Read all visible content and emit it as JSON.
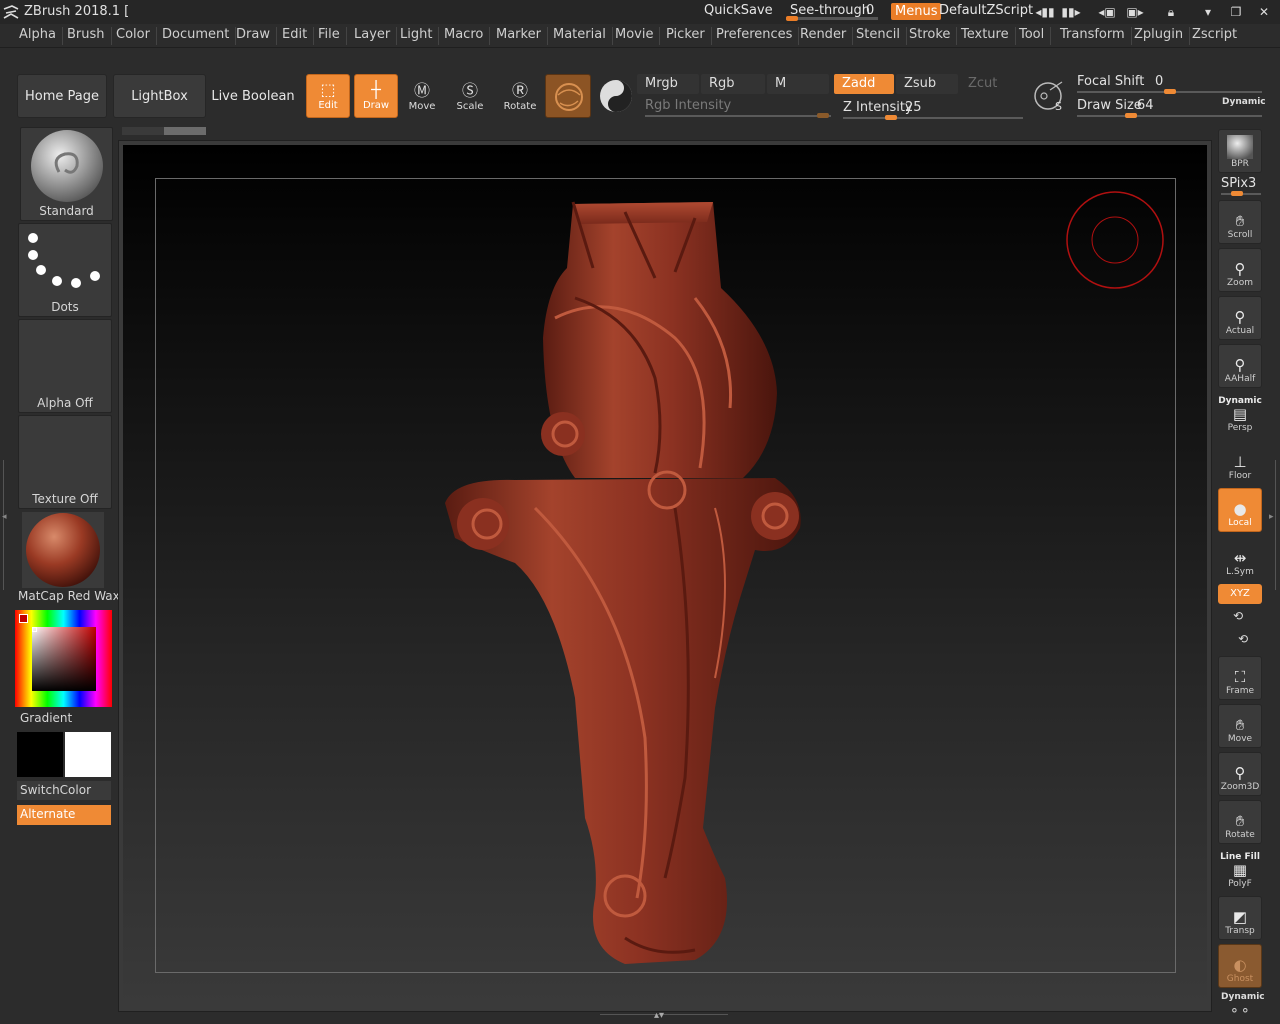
{
  "app": {
    "title": "ZBrush 2018.1 [",
    "quicksave": "QuickSave",
    "see_through_label": "See-through",
    "see_through_value": "0",
    "menus_button": "Menus",
    "default_script": "DefaultZScript"
  },
  "menubar": [
    "Alpha",
    "Brush",
    "Color",
    "Document",
    "Draw",
    "Edit",
    "File",
    "Layer",
    "Light",
    "Macro",
    "Marker",
    "Material",
    "Movie",
    "Picker",
    "Preferences",
    "Render",
    "Stencil",
    "Stroke",
    "Texture",
    "Tool",
    "Transform",
    "Zplugin",
    "Zscript"
  ],
  "toolbar": {
    "home_page": "Home Page",
    "lightbox": "LightBox",
    "live_boolean": "Live Boolean",
    "edit": "Edit",
    "draw": "Draw",
    "move": "Move",
    "scale": "Scale",
    "rotate": "Rotate",
    "mrgb": "Mrgb",
    "rgb": "Rgb",
    "m": "M",
    "zadd": "Zadd",
    "zsub": "Zsub",
    "zcut": "Zcut",
    "rgb_intensity": "Rgb Intensity",
    "z_intensity_label": "Z Intensity",
    "z_intensity_value": "25",
    "focal_shift_label": "Focal Shift",
    "focal_shift_value": "0",
    "draw_size_label": "Draw Size",
    "draw_size_value": "64",
    "dynamic": "Dynamic",
    "z_intensity_fraction": 0.25,
    "focal_shift_fraction": 0.5,
    "draw_size_fraction": 0.28
  },
  "left_panel": {
    "brush": "Standard",
    "stroke": "Dots",
    "alpha": "Alpha Off",
    "texture": "Texture Off",
    "material": "MatCap Red Wax",
    "gradient": "Gradient",
    "switch_color": "SwitchColor",
    "alternate": "Alternate"
  },
  "right_shelf": {
    "bpr": "BPR",
    "spix_label": "SPix",
    "spix_value": "3",
    "scroll": "Scroll",
    "zoom": "Zoom",
    "actual": "Actual",
    "aahalf": "AAHalf",
    "persp_top": "Dynamic",
    "persp": "Persp",
    "floor": "Floor",
    "local": "Local",
    "lsym": "L.Sym",
    "xyz": "XYZ",
    "frame": "Frame",
    "move": "Move",
    "zoom3d": "Zoom3D",
    "rotate": "Rotate",
    "polyf_top": "Line Fill",
    "polyf": "PolyF",
    "transp": "Transp",
    "ghost": "Ghost",
    "solo_top": "Dynamic"
  },
  "colors": {
    "accent": "#ef8a35",
    "model": "#8a3424",
    "background": "#2c2c2c"
  }
}
